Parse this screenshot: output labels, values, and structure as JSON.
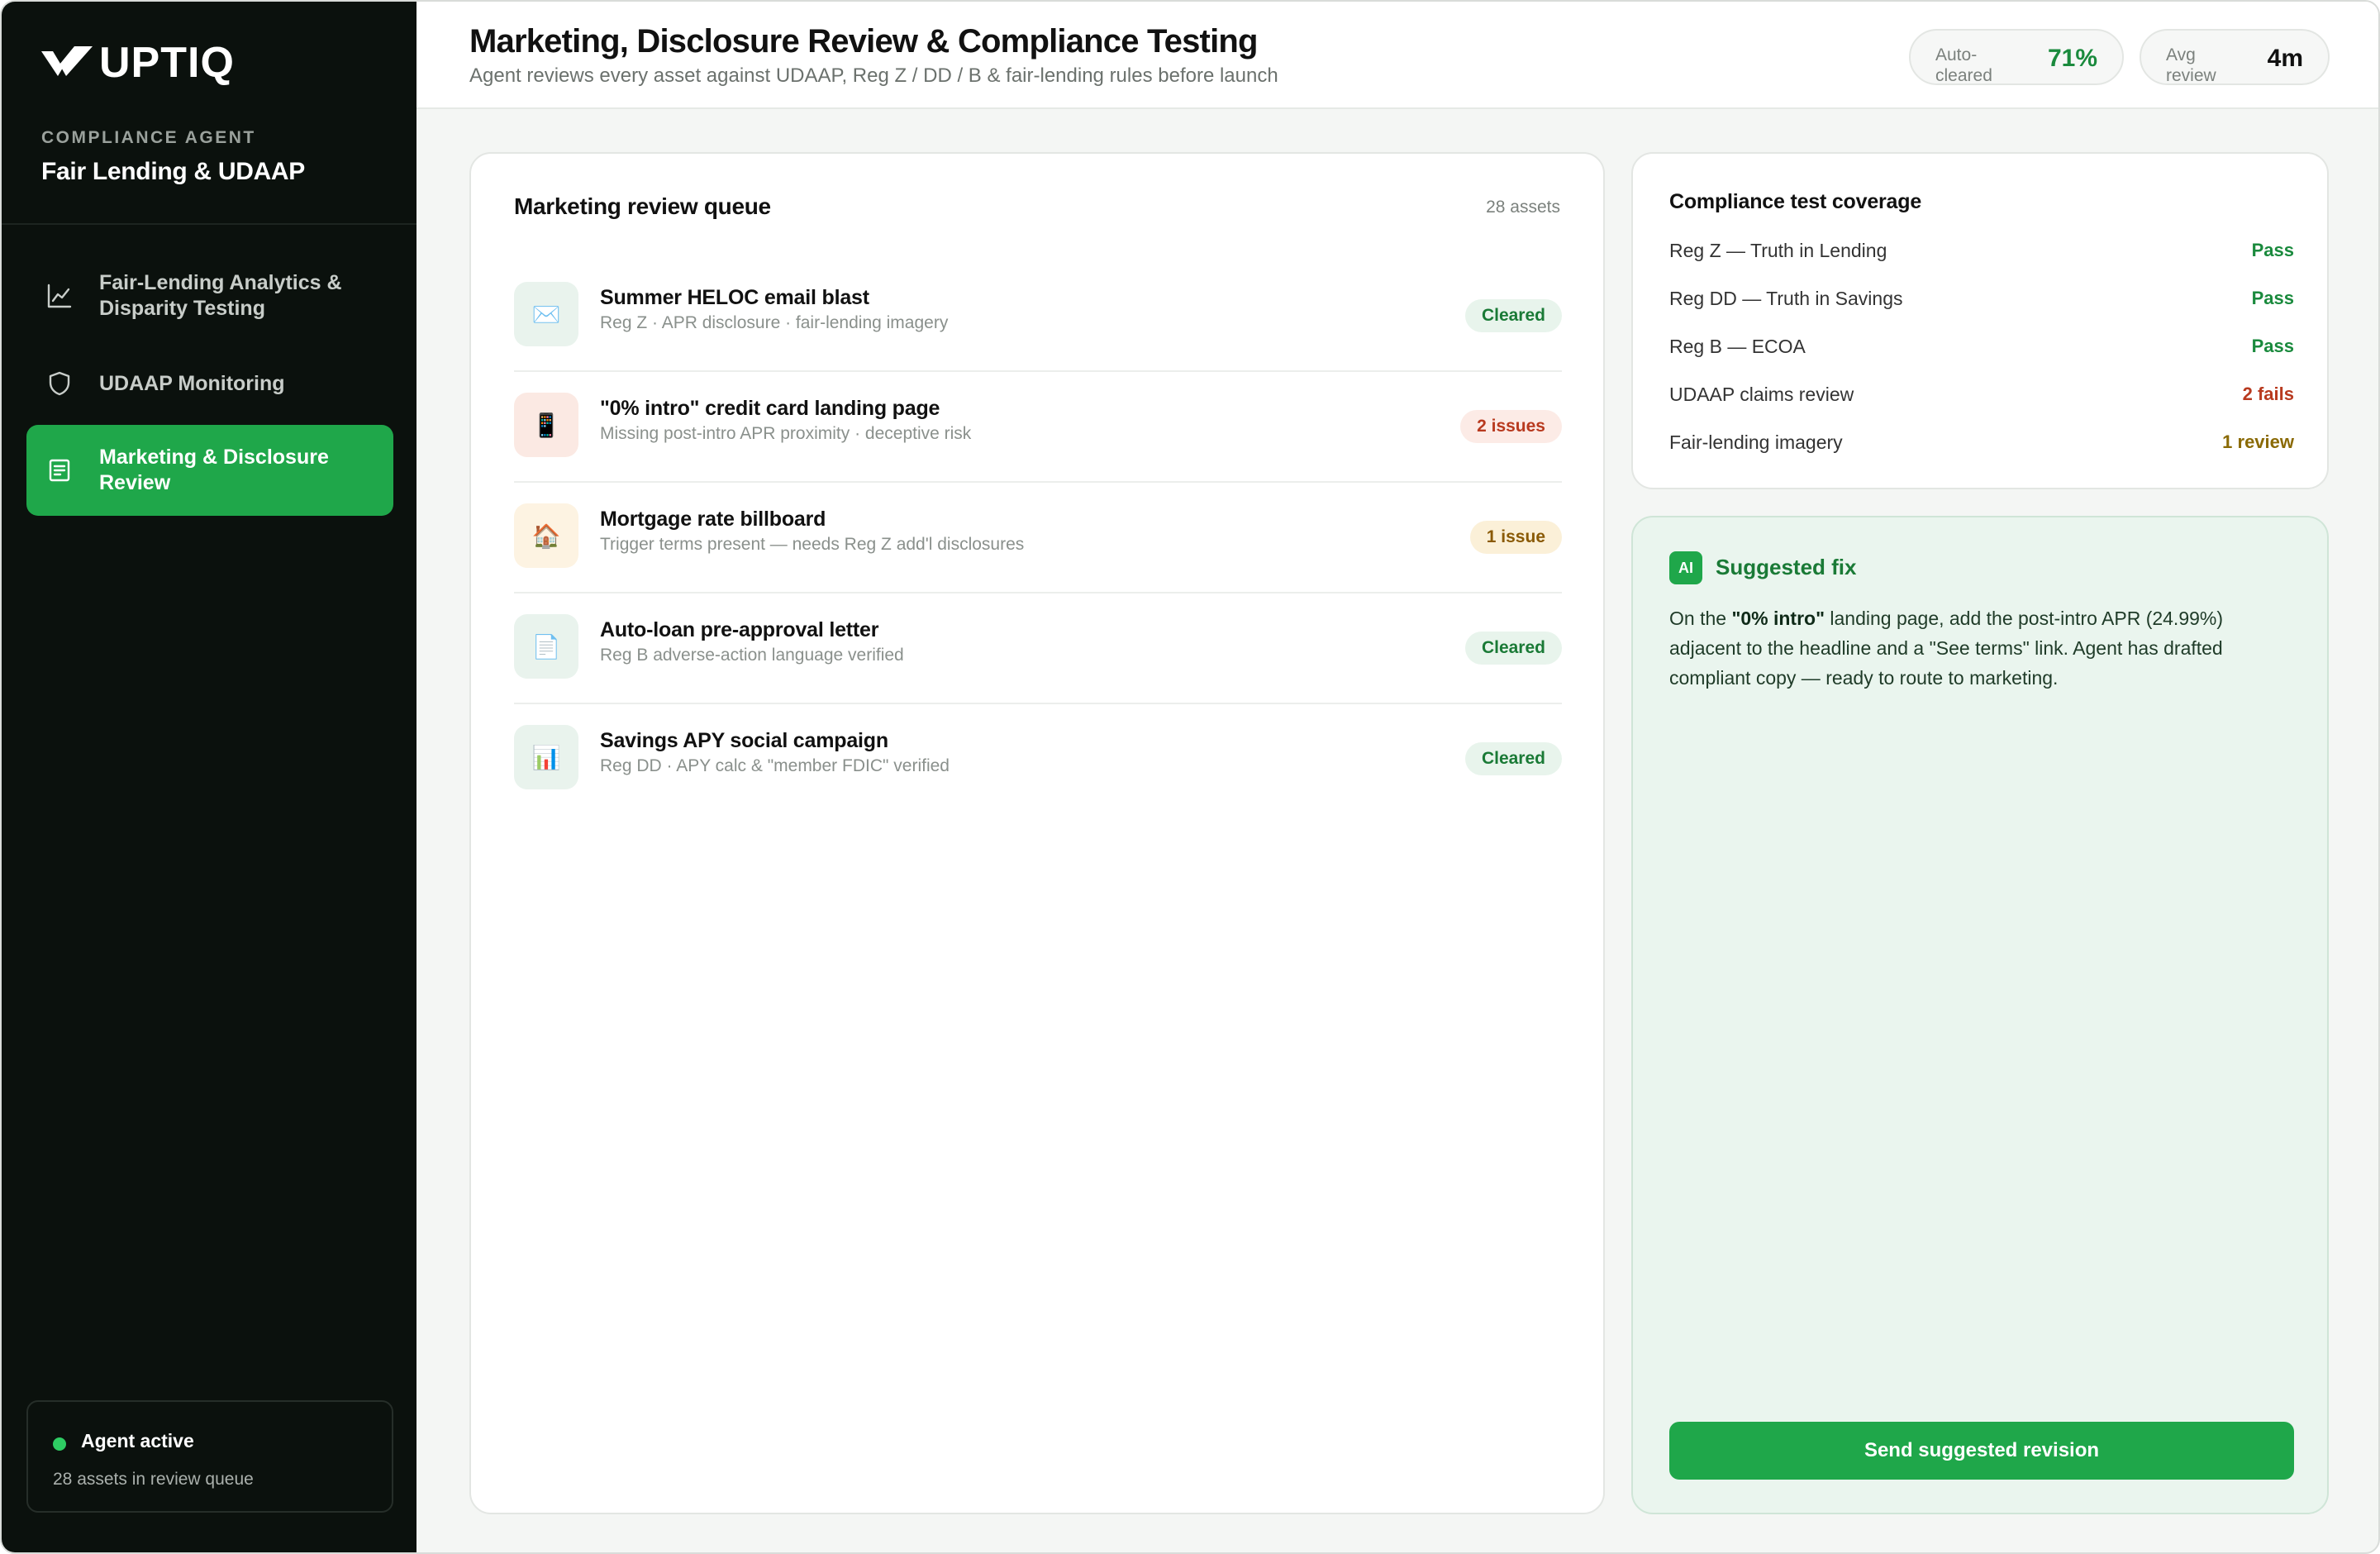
{
  "sidebar": {
    "logo_text": "UPTIQ",
    "agent_kicker": "COMPLIANCE AGENT",
    "agent_name": "Fair Lending & UDAAP",
    "nav": [
      {
        "label": "Fair-Lending Analytics & Disparity Testing",
        "icon": "line-chart-icon",
        "active": false
      },
      {
        "label": "UDAAP Monitoring",
        "icon": "shield-icon",
        "active": false
      },
      {
        "label": "Marketing & Disclosure Review",
        "icon": "document-icon",
        "active": true
      }
    ],
    "status": {
      "title": "Agent active",
      "subtitle": "28 assets in review queue"
    }
  },
  "header": {
    "title": "Marketing, Disclosure Review & Compliance Testing",
    "subtitle": "Agent reviews every asset against UDAAP, Reg Z / DD / B & fair-lending rules before launch",
    "kpis": [
      {
        "label": "Auto-cleared",
        "value": "71%"
      },
      {
        "label": "Avg review",
        "value": "4m"
      }
    ]
  },
  "queue": {
    "title": "Marketing review queue",
    "count": "28 assets",
    "items": [
      {
        "icon": "✉️",
        "icon_name": "email-icon",
        "name": "Summer HELOC email blast",
        "desc": "Reg Z · APR disclosure · fair-lending imagery",
        "badge": "Cleared",
        "status": "ok"
      },
      {
        "icon": "📱",
        "icon_name": "phone-icon",
        "name": "\"0% intro\" credit card landing page",
        "desc": "Missing post-intro APR proximity · deceptive risk",
        "badge": "2 issues",
        "status": "bad"
      },
      {
        "icon": "🏠",
        "icon_name": "house-icon",
        "name": "Mortgage rate billboard",
        "desc": "Trigger terms present — needs Reg Z add'l disclosures",
        "badge": "1 issue",
        "status": "warn"
      },
      {
        "icon": "📄",
        "icon_name": "letter-icon",
        "name": "Auto-loan pre-approval letter",
        "desc": "Reg B adverse-action language verified",
        "badge": "Cleared",
        "status": "ok"
      },
      {
        "icon": "📊",
        "icon_name": "bar-chart-icon",
        "name": "Savings APY social campaign",
        "desc": "Reg DD · APY calc & \"member FDIC\" verified",
        "badge": "Cleared",
        "status": "ok"
      }
    ]
  },
  "coverage": {
    "title": "Compliance test coverage",
    "rows": [
      {
        "name": "Reg Z — Truth in Lending",
        "result": "Pass",
        "status": "pass"
      },
      {
        "name": "Reg DD — Truth in Savings",
        "result": "Pass",
        "status": "pass"
      },
      {
        "name": "Reg B — ECOA",
        "result": "Pass",
        "status": "pass"
      },
      {
        "name": "UDAAP claims review",
        "result": "2 fails",
        "status": "fail"
      },
      {
        "name": "Fair-lending imagery",
        "result": "1 review",
        "status": "review"
      }
    ]
  },
  "fix": {
    "badge": "AI",
    "title": "Suggested fix",
    "body_pre": "On the ",
    "body_bold": "\"0% intro\"",
    "body_post": " landing page, add the post-intro APR (24.99%) adjacent to the headline and a \"See terms\" link. Agent has drafted compliant copy — ready to route to marketing.",
    "button": "Send suggested revision"
  },
  "colors": {
    "sidebar_bg": "#0b110d",
    "accent_green": "#1fa74a",
    "pass": "#1a8a3d",
    "fail": "#b83a1f",
    "review": "#8a6a05"
  }
}
